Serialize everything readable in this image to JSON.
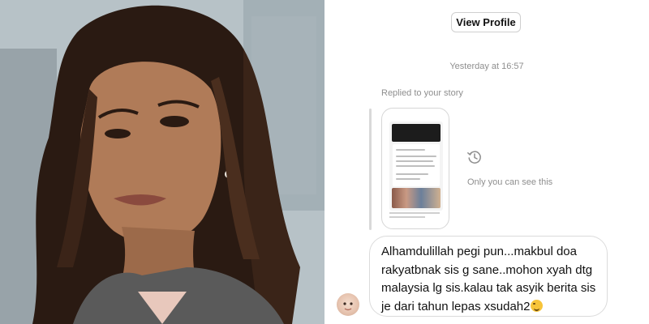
{
  "profile": {
    "view_profile_label": "View Profile"
  },
  "conversation": {
    "timestamp": "Yesterday at 16:57",
    "reply_label": "Replied to your story",
    "visibility_note": "Only you can see this",
    "message_lines": [
      "Alhamdulillah pegi pun...makbul doa",
      "rakyatbnak sis g sane..mohon xyah dtg",
      "malaysia lg sis.kalau tak asyik berita sis",
      "je dari tahun lepas xsudah2"
    ]
  },
  "icons": {
    "history": "history-icon",
    "emoji": "grinning-squinting-face-icon"
  },
  "colors": {
    "muted_text": "#8e8e8e",
    "bubble_border": "#dbdbdb",
    "reply_bar": "#d9d9d9"
  }
}
